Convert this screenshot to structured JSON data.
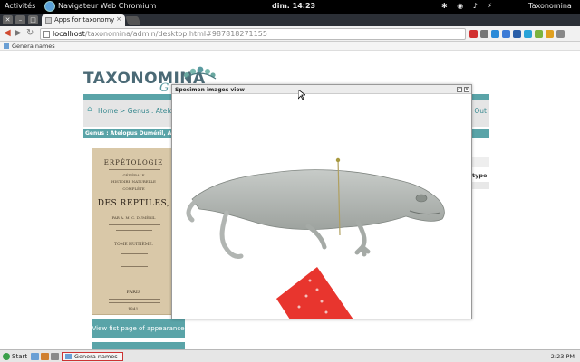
{
  "system_bar": {
    "activities": "Activités",
    "app_name": "Navigateur Web Chromium",
    "clock": "dim. 14:23",
    "user": "Taxonomina"
  },
  "browser": {
    "tab_title": "Apps for taxonomy",
    "url_host": "localhost",
    "url_path": "/taxonomina/admin/desktop.html#987818271155",
    "bookmark_label": "Genera names",
    "extension_colors": [
      "#d23030",
      "#777777",
      "#2a8ad8",
      "#3c7bd6",
      "#2b5fa8",
      "#29a3d8",
      "#7bb33f",
      "#e0a020",
      "#888888"
    ]
  },
  "page": {
    "logo_text": "TAXONOMINA",
    "logo_g": "G",
    "nav": {
      "home_label": "Home",
      "genus_label": "> Genus : Atelopus",
      "logout_label": "Out"
    },
    "info_bar": "Genus : Atelopus Duméril, A.M.C., Bib",
    "book": {
      "title_top": "ERPÉTOLOGIE",
      "sub1": "GÉNÉRALE",
      "sub2": "HISTOIRE NATURELLE",
      "sub3": "COMPLÈTE",
      "title_main": "DES REPTILES,",
      "authors": "PAR A. M. C. DUMÉRIL",
      "tome": "TOME HUITIÈME.",
      "city": "PARIS",
      "year": "1841."
    },
    "view_button": "View fist page of appearance",
    "type_label": "type"
  },
  "dialog": {
    "title": "Specimen images view",
    "min_symbol": "▭",
    "close_symbol": "✕"
  },
  "taskbar": {
    "start_label": "Start",
    "task_item": "Genera names",
    "clock": "2:23 PM"
  },
  "colors": {
    "accent_teal": "#5aa4a8",
    "logo_slate": "#4b6a76",
    "tag_red": "#e8352e"
  }
}
